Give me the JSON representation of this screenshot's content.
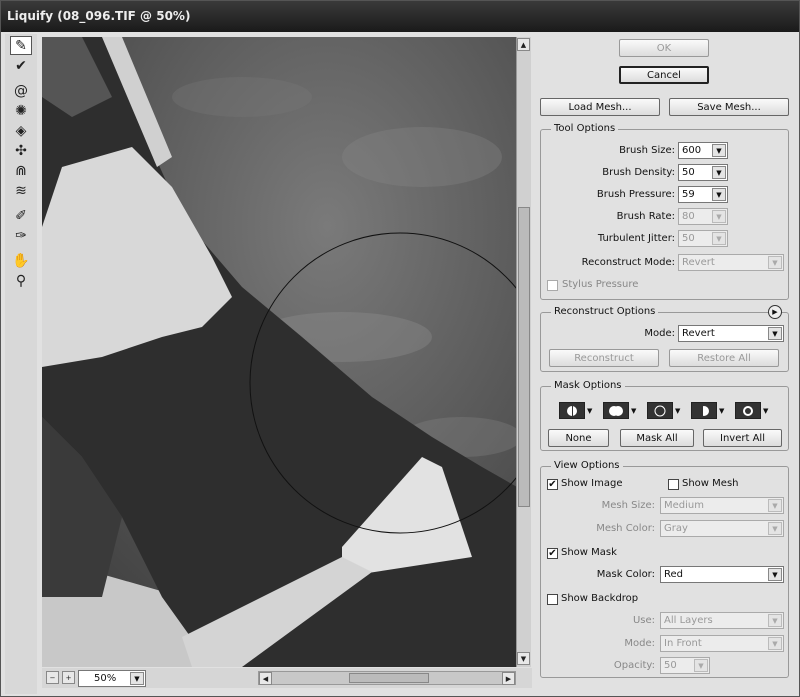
{
  "title": "Liquify (08_096.TIF @ 50%)",
  "tools": [
    {
      "name": "forward-warp-icon",
      "glyph": "✎"
    },
    {
      "name": "reconstruct-icon",
      "glyph": "✔"
    },
    {
      "name": "twirl-icon",
      "glyph": "@"
    },
    {
      "name": "pucker-icon",
      "glyph": "✺"
    },
    {
      "name": "bloat-icon",
      "glyph": "◈"
    },
    {
      "name": "push-left-icon",
      "glyph": "✣"
    },
    {
      "name": "mirror-icon",
      "glyph": "ᕮ"
    },
    {
      "name": "turbulence-icon",
      "glyph": "≋"
    },
    {
      "name": "freeze-mask-icon",
      "glyph": "✐"
    },
    {
      "name": "thaw-mask-icon",
      "glyph": "✑"
    },
    {
      "name": "hand-icon",
      "glyph": "✋"
    },
    {
      "name": "zoom-icon",
      "glyph": "🔍"
    }
  ],
  "zoom_value": "50%",
  "buttons": {
    "ok": "OK",
    "cancel": "Cancel",
    "load_mesh": "Load Mesh...",
    "save_mesh": "Save Mesh..."
  },
  "tool_options": {
    "legend": "Tool Options",
    "brush_size_label": "Brush Size:",
    "brush_size": "600",
    "brush_density_label": "Brush Density:",
    "brush_density": "50",
    "brush_pressure_label": "Brush Pressure:",
    "brush_pressure": "59",
    "brush_rate_label": "Brush Rate:",
    "brush_rate": "80",
    "turbulent_jitter_label": "Turbulent Jitter:",
    "turbulent_jitter": "50",
    "reconstruct_mode_label": "Reconstruct Mode:",
    "reconstruct_mode": "Revert",
    "stylus_pressure": "Stylus Pressure"
  },
  "reconstruct_options": {
    "legend": "Reconstruct Options",
    "mode_label": "Mode:",
    "mode": "Revert",
    "reconstruct": "Reconstruct",
    "restore_all": "Restore All"
  },
  "mask_options": {
    "legend": "Mask Options",
    "none": "None",
    "mask_all": "Mask All",
    "invert_all": "Invert All"
  },
  "view_options": {
    "legend": "View Options",
    "show_image": "Show Image",
    "show_image_checked": "✔",
    "show_mesh": "Show Mesh",
    "mesh_size_label": "Mesh Size:",
    "mesh_size": "Medium",
    "mesh_color_label": "Mesh Color:",
    "mesh_color": "Gray",
    "show_mask": "Show Mask",
    "show_mask_checked": "✔",
    "mask_color_label": "Mask Color:",
    "mask_color": "Red",
    "show_backdrop": "Show Backdrop",
    "use_label": "Use:",
    "use": "All Layers",
    "mode_label": "Mode:",
    "mode": "In Front",
    "opacity_label": "Opacity:",
    "opacity": "50"
  }
}
